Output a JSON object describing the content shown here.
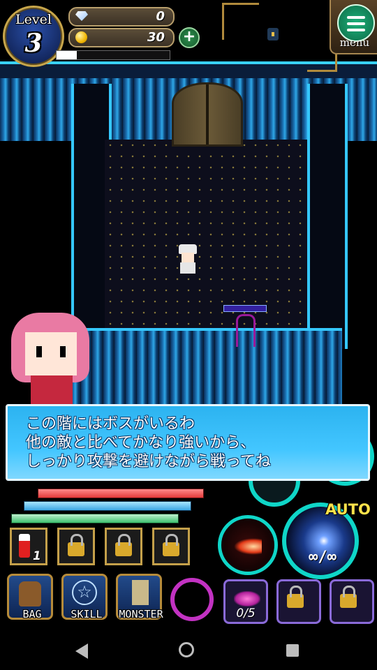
{
  "hud": {
    "level_label": "Level",
    "level_value": "3",
    "gems": "0",
    "coins": "30",
    "exp_fraction": 0.18,
    "menu_label": "menu"
  },
  "dialog": {
    "lines": [
      "この階にはボスがいるわ",
      "他の敵と比べてかなり強いから、",
      "しっかり攻撃を避けながら戦ってね"
    ]
  },
  "items": {
    "potion_count": "1"
  },
  "menu_buttons": {
    "bag": "BAG",
    "skill": "SKILL",
    "monster": "MONSTER"
  },
  "skill_slot": {
    "count": "0/5"
  },
  "actions": {
    "auto_label": "AUTO",
    "ammo": "∞/∞"
  },
  "colors": {
    "wall_glow": "#35c8ff",
    "dialog_bg": "#2cb3f0",
    "hp": "#e23a3a",
    "mp": "#3aa6e2",
    "sp": "#3ec06e",
    "ring": "#0fd6c8",
    "gold": "#c4a04a"
  }
}
